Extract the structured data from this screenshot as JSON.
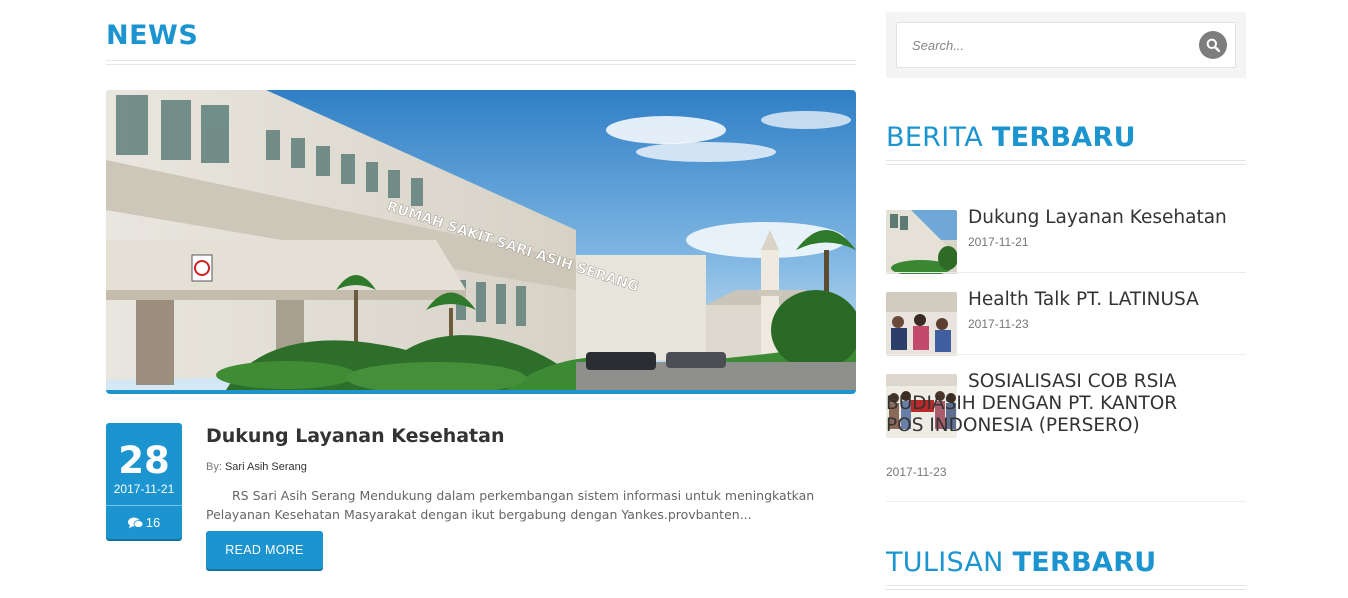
{
  "main": {
    "section_title": "NEWS",
    "post": {
      "day": "28",
      "date": "2017-11-21",
      "comments": "16",
      "title": "Dukung Layanan Kesehatan",
      "by_label": "By:",
      "author": "Sari Asih Serang",
      "excerpt": "RS Sari Asih Serang Mendukung dalam perkembangan sistem informasi untuk meningkatkan Pelayanan Kesehatan Masyarakat dengan ikut bergabung dengan Yankes.provbanten...",
      "read_more": "READ MORE",
      "image_sign": "RUMAH SAKIT SARI ASIH SERANG"
    }
  },
  "sidebar": {
    "search_placeholder": "Search...",
    "widget1_light": "BERITA",
    "widget1_bold": "TERBARU",
    "news": [
      {
        "title": "Dukung Layanan Kesehatan",
        "date": "2017-11-21"
      },
      {
        "title": "Health Talk PT. LATINUSA",
        "date": "2017-11-23"
      },
      {
        "title": "SOSIALISASI COB RSIA BUDIASIH DENGAN PT. KANTOR POS INDONESIA (PERSERO)",
        "date": "2017-11-23"
      }
    ],
    "widget2_light": "TULISAN",
    "widget2_bold": "TERBARU"
  },
  "colors": {
    "accent": "#1b94cf",
    "text_dark": "#333333",
    "text_muted": "#777777"
  },
  "icons": [
    "search-icon",
    "comments-icon"
  ]
}
